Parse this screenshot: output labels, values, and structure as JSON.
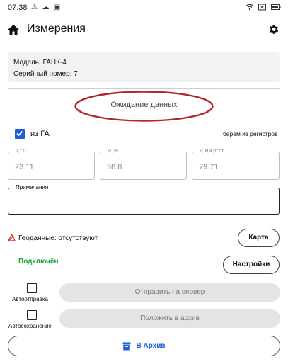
{
  "status_bar": {
    "time": "07:38",
    "icons_left": [
      "alert-icon",
      "cloud-icon",
      "square-icon"
    ],
    "icons_right": [
      "wifi-icon",
      "battery-x-icon",
      "battery-icon"
    ]
  },
  "app_bar": {
    "title": "Измерения",
    "home_icon": "home-icon",
    "settings_icon": "gear-icon"
  },
  "device": {
    "model": "Модель: ГАНК-4",
    "serial": "Серийный номер: 7"
  },
  "status_message": "Ожидание данных",
  "source": {
    "checkbox_label": "из ГА",
    "checked": true,
    "register_note": "берём из регистров"
  },
  "fields": [
    {
      "label": "T, °C",
      "value": "23.11"
    },
    {
      "label": "H, %",
      "value": "38.8"
    },
    {
      "label": "P, мм рт.ст.",
      "value": "79.71"
    }
  ],
  "notes": {
    "label": "Примечания",
    "value": ""
  },
  "geo": {
    "text": "Геоданные: отсутствуют",
    "map_button": "Карта"
  },
  "connection": {
    "status": "Подключён",
    "settings_button": "Настройки"
  },
  "auto_send": {
    "label": "Автоотправка",
    "checked": false,
    "button": "Отправить на сервер"
  },
  "auto_save": {
    "label": "Автосохранение",
    "checked": false,
    "button": "Положить в архив"
  },
  "archive_button": "В Архив",
  "colors": {
    "accent": "#1e5fd8",
    "connected": "#19a33a",
    "annotation": "#b3262e",
    "warning": "#c62828"
  }
}
